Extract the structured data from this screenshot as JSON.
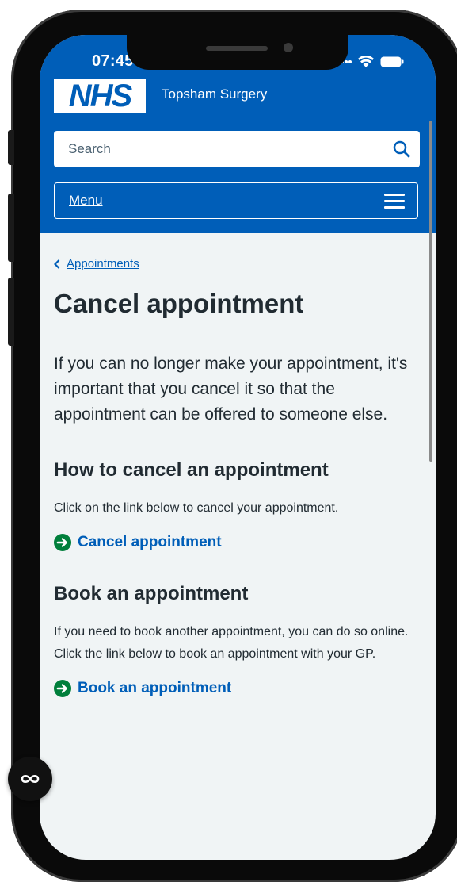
{
  "status_bar": {
    "time": "07:45"
  },
  "header": {
    "logo_text": "NHS",
    "organisation": "Topsham Surgery"
  },
  "search": {
    "placeholder": "Search"
  },
  "menu": {
    "label": "Menu"
  },
  "breadcrumb": {
    "label": "Appointments"
  },
  "page": {
    "title": "Cancel appointment",
    "lede": "If you can no longer make your appointment, it's important that you cancel it so that the appointment can be offered to someone else.",
    "sections": [
      {
        "heading": "How to cancel an appointment",
        "body": "Click on the link below to cancel your appointment.",
        "action": "Cancel appointment"
      },
      {
        "heading": "Book an appointment",
        "body": "If you need to book another appointment, you can do so online. Click the link below to book an appointment with your GP.",
        "action": "Book an appointment"
      }
    ]
  },
  "colors": {
    "nhs_blue": "#005eb8",
    "action_green": "#007f3b",
    "text": "#212b32",
    "background": "#f0f4f5"
  },
  "icons": [
    "search-icon",
    "hamburger-icon",
    "chevron-left-icon",
    "arrow-right-circle-icon",
    "infinity-icon",
    "wifi-icon",
    "battery-icon"
  ]
}
